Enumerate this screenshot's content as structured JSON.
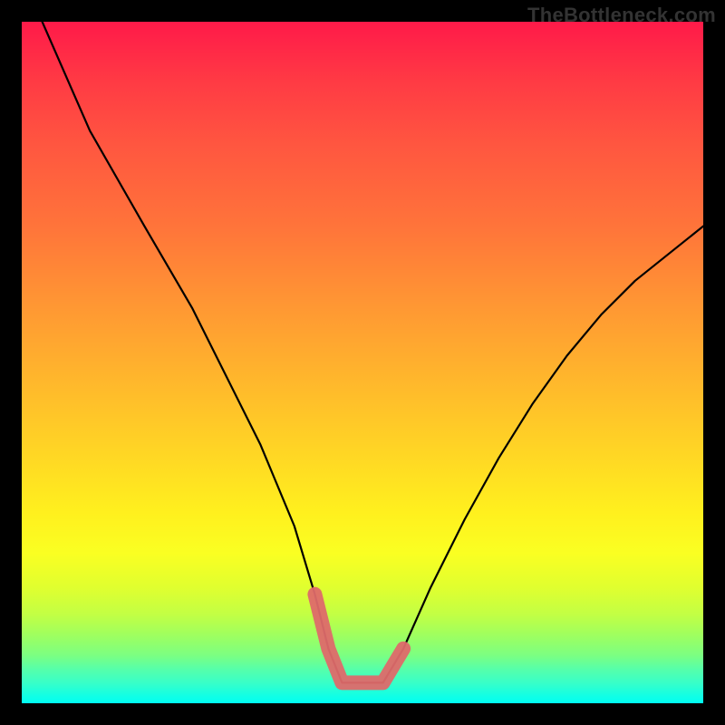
{
  "watermark_text": "TheBottleneck.com",
  "chart_data": {
    "type": "line",
    "title": "",
    "xlabel": "",
    "ylabel": "",
    "xlim": [
      0,
      100
    ],
    "ylim": [
      0,
      100
    ],
    "x": [
      3,
      10,
      18,
      25,
      30,
      35,
      40,
      43,
      45,
      47,
      49,
      53,
      56,
      60,
      65,
      70,
      75,
      80,
      85,
      90,
      95,
      100
    ],
    "values": [
      100,
      84,
      70,
      58,
      48,
      38,
      26,
      16,
      8,
      3,
      3,
      3,
      8,
      17,
      27,
      36,
      44,
      51,
      57,
      62,
      66,
      70
    ],
    "series": [
      {
        "name": "curve",
        "color": "#000000",
        "values": [
          100,
          84,
          70,
          58,
          48,
          38,
          26,
          16,
          8,
          3,
          3,
          3,
          8,
          17,
          27,
          36,
          44,
          51,
          57,
          62,
          66,
          70
        ]
      },
      {
        "name": "valley-highlight",
        "color": "#e06666",
        "values_x": [
          43,
          45,
          47,
          49,
          53,
          56
        ],
        "values_y": [
          16,
          8,
          3,
          3,
          3,
          8
        ]
      }
    ],
    "gradient": {
      "orientation": "vertical",
      "stops": [
        {
          "pos": 0.0,
          "color": "#ff1a49"
        },
        {
          "pos": 0.3,
          "color": "#ff743a"
        },
        {
          "pos": 0.64,
          "color": "#ffd824"
        },
        {
          "pos": 0.83,
          "color": "#e0ff2f"
        },
        {
          "pos": 0.95,
          "color": "#56ffaa"
        },
        {
          "pos": 1.0,
          "color": "#00fff2"
        }
      ]
    }
  }
}
